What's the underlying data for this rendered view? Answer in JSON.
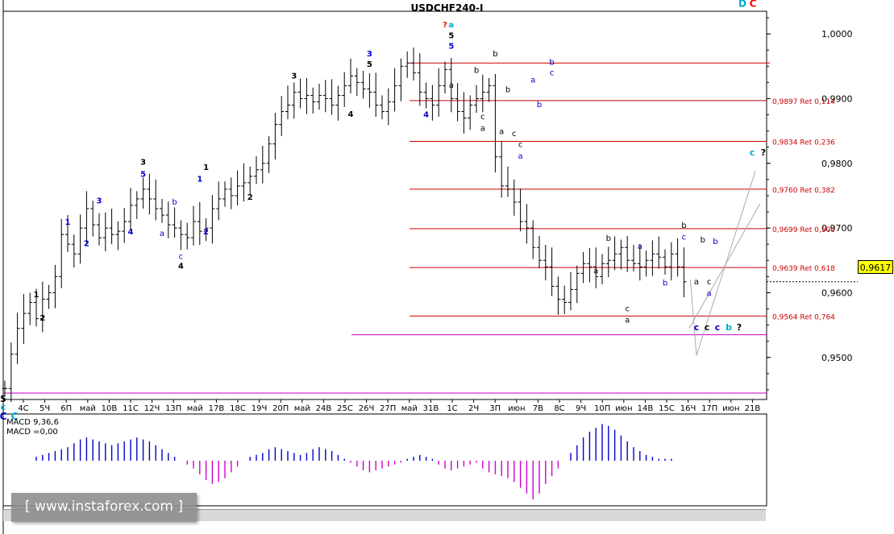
{
  "title": "USDCHF240-I",
  "last_price_label": "0,9617",
  "watermark": "[ www.instaforex.com ]",
  "macd_labels": [
    "MACD 9,36,6",
    "MACD =0,00"
  ],
  "colors": {
    "candles": "#000000",
    "fib_line": "#cc0000",
    "fib_label": "#cc0000",
    "support_line": "#cc00cc",
    "macd_positive": "#0000cc",
    "macd_negative": "#cc00cc",
    "wave_black": "#000000",
    "wave_blue": "#0000cc",
    "wave_teal": "#00aacc",
    "wave_red": "#ff0000",
    "price_tag": "#ffff00"
  },
  "chart_data": {
    "type": "candlestick",
    "symbol": "USDCHF",
    "timeframe": "H4",
    "ylim": [
      0.9435,
      1.0035
    ],
    "y_ticks": [
      {
        "value": 1.0,
        "label": "1,0000"
      },
      {
        "value": 0.99,
        "label": "0,9900"
      },
      {
        "value": 0.98,
        "label": "0,9800"
      },
      {
        "value": 0.97,
        "label": "0,9700"
      },
      {
        "value": 0.96,
        "label": "0,9600"
      },
      {
        "value": 0.95,
        "label": "0,9500"
      }
    ],
    "x_tick_labels": [
      "4C",
      "5Ч",
      "6П",
      "май",
      "10В",
      "11C",
      "12Ч",
      "13П",
      "май",
      "17В",
      "18C",
      "19Ч",
      "20П",
      "май",
      "24В",
      "25C",
      "26Ч",
      "27П",
      "май",
      "31В",
      "1C",
      "2Ч",
      "3П",
      "июн",
      "7В",
      "8C",
      "9Ч",
      "10П",
      "июн",
      "14В",
      "15C",
      "16Ч",
      "17П",
      "июн",
      "21В"
    ],
    "last_price": 0.9617,
    "closes": [
      0.9452,
      0.9505,
      0.9545,
      0.9568,
      0.9585,
      0.956,
      0.959,
      0.96,
      0.9625,
      0.969,
      0.9675,
      0.966,
      0.97,
      0.973,
      0.9705,
      0.9685,
      0.97,
      0.969,
      0.9695,
      0.971,
      0.9735,
      0.9745,
      0.976,
      0.9745,
      0.973,
      0.972,
      0.9705,
      0.97,
      0.969,
      0.9685,
      0.971,
      0.9695,
      0.97,
      0.973,
      0.9745,
      0.976,
      0.975,
      0.9765,
      0.977,
      0.978,
      0.979,
      0.98,
      0.983,
      0.986,
      0.988,
      0.989,
      0.991,
      0.99,
      0.9905,
      0.9895,
      0.9905,
      0.99,
      0.989,
      0.9905,
      0.992,
      0.9935,
      0.9925,
      0.9915,
      0.991,
      0.989,
      0.988,
      0.9895,
      0.992,
      0.995,
      0.9955,
      0.994,
      0.991,
      0.99,
      0.989,
      0.992,
      0.9945,
      0.99,
      0.988,
      0.987,
      0.989,
      0.99,
      0.991,
      0.992,
      0.981,
      0.9765,
      0.976,
      0.974,
      0.971,
      0.97,
      0.967,
      0.965,
      0.964,
      0.961,
      0.959,
      0.9585,
      0.9605,
      0.963,
      0.9645,
      0.964,
      0.9625,
      0.9645,
      0.965,
      0.966,
      0.967,
      0.965,
      0.9645,
      0.964,
      0.965,
      0.966,
      0.9655,
      0.964,
      0.966,
      0.964,
      0.9617
    ],
    "fib_levels": [
      {
        "value": 0.9897,
        "label": "0,9897 Ret 0,114"
      },
      {
        "value": 0.9834,
        "label": "0,9834 Ret 0,236"
      },
      {
        "value": 0.976,
        "label": "0,9760 Ret 0,382"
      },
      {
        "value": 0.9699,
        "label": "0,9699 Ret 0,500"
      },
      {
        "value": 0.9639,
        "label": "0,9639 Ret 0,618"
      },
      {
        "value": 0.9564,
        "label": "0,9564 Ret 0,764"
      }
    ],
    "top_resistance": 0.9955,
    "support_lines": [
      0.9535,
      0.9445
    ],
    "macd_hist": [
      0,
      0,
      0,
      0,
      0,
      0.1,
      0.15,
      0.2,
      0.25,
      0.3,
      0.35,
      0.45,
      0.55,
      0.6,
      0.55,
      0.5,
      0.45,
      0.4,
      0.45,
      0.5,
      0.55,
      0.6,
      0.55,
      0.5,
      0.4,
      0.3,
      0.2,
      0.1,
      0,
      -0.1,
      -0.2,
      -0.35,
      -0.5,
      -0.6,
      -0.55,
      -0.45,
      -0.3,
      -0.15,
      0,
      0.1,
      0.15,
      0.2,
      0.3,
      0.35,
      0.3,
      0.25,
      0.2,
      0.15,
      0.2,
      0.3,
      0.35,
      0.3,
      0.25,
      0.15,
      0.05,
      -0.05,
      -0.15,
      -0.25,
      -0.3,
      -0.25,
      -0.2,
      -0.15,
      -0.1,
      -0.05,
      0.05,
      0.1,
      0.15,
      0.1,
      0.05,
      -0.1,
      -0.2,
      -0.25,
      -0.2,
      -0.15,
      -0.1,
      -0.05,
      -0.2,
      -0.3,
      -0.35,
      -0.4,
      -0.45,
      -0.55,
      -0.7,
      -0.85,
      -1.0,
      -0.85,
      -0.6,
      -0.4,
      -0.2,
      0,
      0.2,
      0.4,
      0.6,
      0.75,
      0.85,
      0.95,
      0.9,
      0.8,
      0.65,
      0.5,
      0.35,
      0.25,
      0.15,
      0.1,
      0.05,
      0.05,
      0.05
    ],
    "wave_labels": [
      {
        "text": "1",
        "i": 5,
        "y": 0.9593,
        "c": "black"
      },
      {
        "text": "2",
        "i": 6,
        "y": 0.9557,
        "c": "black"
      },
      {
        "text": "1",
        "i": 10,
        "y": 0.9705,
        "c": "blue"
      },
      {
        "text": "2",
        "i": 13,
        "y": 0.9672,
        "c": "blue"
      },
      {
        "text": "3",
        "i": 15,
        "y": 0.9738,
        "c": "blue"
      },
      {
        "text": "4",
        "i": 20,
        "y": 0.969,
        "c": "blue"
      },
      {
        "text": "5",
        "i": 22,
        "y": 0.9779,
        "c": "blue"
      },
      {
        "text": "3",
        "i": 22,
        "y": 0.9798,
        "c": "black"
      },
      {
        "text": "a",
        "i": 25,
        "y": 0.9688,
        "c": "blue"
      },
      {
        "text": "b",
        "i": 27,
        "y": 0.9736,
        "c": "blue"
      },
      {
        "text": "c",
        "i": 28,
        "y": 0.9652,
        "c": "blue"
      },
      {
        "text": "4",
        "i": 28,
        "y": 0.9637,
        "c": "black"
      },
      {
        "text": "1",
        "i": 31,
        "y": 0.9772,
        "c": "blue"
      },
      {
        "text": "2",
        "i": 32,
        "y": 0.969,
        "c": "blue"
      },
      {
        "text": "1",
        "i": 32,
        "y": 0.979,
        "c": "black"
      },
      {
        "text": "2",
        "i": 39,
        "y": 0.9744,
        "c": "black"
      },
      {
        "text": "3",
        "i": 46,
        "y": 0.9931,
        "c": "black"
      },
      {
        "text": "4",
        "i": 55,
        "y": 0.9872,
        "c": "black"
      },
      {
        "text": "3",
        "i": 58,
        "y": 0.9965,
        "c": "blue"
      },
      {
        "text": "5",
        "i": 58,
        "y": 0.9949,
        "c": "black"
      },
      {
        "text": "4",
        "i": 67,
        "y": 0.9871,
        "c": "blue"
      },
      {
        "text": "?",
        "i": 70,
        "y": 1.001,
        "c": "red"
      },
      {
        "text": "a",
        "i": 71,
        "y": 1.001,
        "c": "teal"
      },
      {
        "text": "5",
        "i": 71,
        "y": 0.9993,
        "c": "black"
      },
      {
        "text": "5",
        "i": 71,
        "y": 0.9977,
        "c": "blue"
      },
      {
        "text": "a",
        "i": 71,
        "y": 0.9917,
        "c": "black"
      },
      {
        "text": "b",
        "i": 78,
        "y": 0.9965,
        "c": "black"
      },
      {
        "text": "b",
        "i": 75,
        "y": 0.994,
        "c": "black"
      },
      {
        "text": "c",
        "i": 76,
        "y": 0.9868,
        "c": "black"
      },
      {
        "text": "a",
        "i": 76,
        "y": 0.985,
        "c": "black"
      },
      {
        "text": "a",
        "i": 79,
        "y": 0.9845,
        "c": "black"
      },
      {
        "text": "b",
        "i": 80,
        "y": 0.991,
        "c": "black"
      },
      {
        "text": "c",
        "i": 81,
        "y": 0.9842,
        "c": "black"
      },
      {
        "text": "c",
        "i": 82,
        "y": 0.9825,
        "c": "black"
      },
      {
        "text": "a",
        "i": 82,
        "y": 0.9807,
        "c": "blue"
      },
      {
        "text": "a",
        "i": 84,
        "y": 0.9925,
        "c": "blue"
      },
      {
        "text": "b",
        "i": 85,
        "y": 0.9887,
        "c": "blue"
      },
      {
        "text": "b",
        "i": 87,
        "y": 0.9952,
        "c": "blue"
      },
      {
        "text": "c",
        "i": 87,
        "y": 0.9936,
        "c": "blue"
      },
      {
        "text": "b",
        "i": 96,
        "y": 0.968,
        "c": "black"
      },
      {
        "text": "a",
        "i": 94,
        "y": 0.963,
        "c": "black"
      },
      {
        "text": "c",
        "i": 99,
        "y": 0.9571,
        "c": "black"
      },
      {
        "text": "a",
        "i": 99,
        "y": 0.9554,
        "c": "black"
      },
      {
        "text": "a",
        "i": 101,
        "y": 0.9668,
        "c": "blue"
      },
      {
        "text": "b",
        "i": 105,
        "y": 0.9611,
        "c": "blue"
      },
      {
        "text": "b",
        "i": 108,
        "y": 0.97,
        "c": "black"
      },
      {
        "text": "c",
        "i": 108,
        "y": 0.9682,
        "c": "blue"
      },
      {
        "text": "a",
        "i": 110,
        "y": 0.9613,
        "c": "black"
      },
      {
        "text": "b",
        "i": 111,
        "y": 0.9678,
        "c": "black"
      },
      {
        "text": "c",
        "i": 112,
        "y": 0.9613,
        "c": "black"
      },
      {
        "text": "b",
        "i": 113,
        "y": 0.9675,
        "c": "blue"
      },
      {
        "text": "a",
        "i": 112,
        "y": 0.9595,
        "c": "blue"
      }
    ],
    "forecast_labels": [
      {
        "text": "c",
        "x": 864,
        "y": 0.9542,
        "c": "blue"
      },
      {
        "text": "c",
        "x": 877,
        "y": 0.9542,
        "c": "black"
      },
      {
        "text": "c",
        "x": 890,
        "y": 0.9542,
        "c": "blue"
      },
      {
        "text": "b",
        "x": 904,
        "y": 0.9542,
        "c": "teal"
      },
      {
        "text": "?",
        "x": 917,
        "y": 0.9542,
        "c": "black"
      },
      {
        "text": "c",
        "x": 933,
        "y": 0.9812,
        "c": "teal"
      },
      {
        "text": "?",
        "x": 947,
        "y": 0.9812,
        "c": "black"
      },
      {
        "text": "D",
        "x": 921,
        "y": 1.0042,
        "c": "teal"
      },
      {
        "text": "C",
        "x": 934,
        "y": 1.0042,
        "c": "red"
      },
      {
        "text": "5",
        "x": 4,
        "y": 0.9431,
        "c": "black"
      },
      {
        "text": "c",
        "x": 4,
        "y": 0.9419,
        "c": "teal"
      },
      {
        "text": "C",
        "x": 4,
        "y": 0.9404,
        "c": "blue"
      },
      {
        "text": "C",
        "x": 18,
        "y": 0.9404,
        "c": "teal"
      }
    ]
  }
}
